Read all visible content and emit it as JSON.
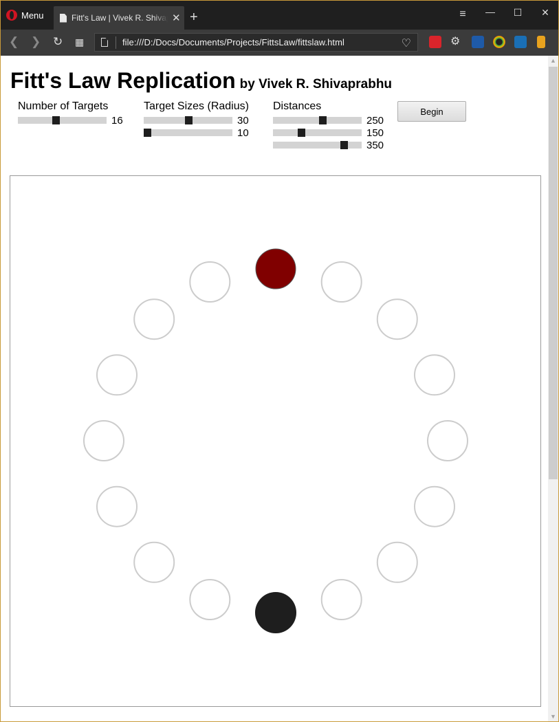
{
  "browser": {
    "menu_label": "Menu",
    "tab_title": "Fitt's Law | Vivek R. Shivaprabhu",
    "url": "file:///D:/Docs/Documents/Projects/FittsLaw/fittslaw.html"
  },
  "page": {
    "title": "Fitt's Law Replication",
    "byline": "by Vivek R. Shivaprabhu",
    "begin_label": "Begin"
  },
  "controls": {
    "num_targets": {
      "label": "Number of Targets",
      "value": "16",
      "fraction": 0.42
    },
    "target_sizes": {
      "label": "Target Sizes (Radius)",
      "sliders": [
        {
          "value": "30",
          "fraction": 0.5
        },
        {
          "value": "10",
          "fraction": 0.0
        }
      ]
    },
    "distances": {
      "label": "Distances",
      "sliders": [
        {
          "value": "250",
          "fraction": 0.56
        },
        {
          "value": "150",
          "fraction": 0.3
        },
        {
          "value": "350",
          "fraction": 0.82
        }
      ]
    }
  },
  "experiment": {
    "target_count": 16,
    "target_radius": 30,
    "distance": 250,
    "highlighted_target_index": 0,
    "cursor_target_index": 8,
    "colors": {
      "highlight": "#800000",
      "cursor": "#1e1e1e",
      "outline": "#cccccc"
    }
  }
}
